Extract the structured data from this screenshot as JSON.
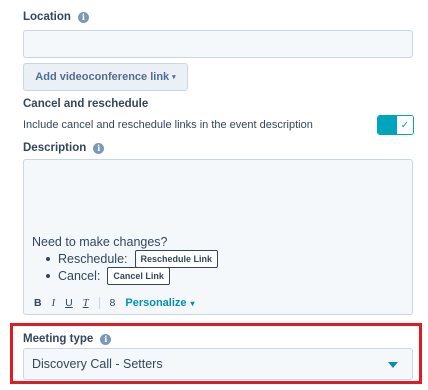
{
  "location": {
    "label": "Location",
    "value": "",
    "placeholder": ""
  },
  "videoconference": {
    "button_label": "Add videoconference link",
    "caret": "▾"
  },
  "cancel_reschedule": {
    "heading": "Cancel and reschedule",
    "description": "Include cancel and reschedule links in the event description",
    "toggle_on": true
  },
  "description": {
    "label": "Description",
    "intro": "Need to make changes?",
    "reschedule_label": "Reschedule:",
    "reschedule_chip": "Reschedule Link",
    "cancel_label": "Cancel:",
    "cancel_chip": "Cancel Link"
  },
  "toolbar": {
    "bold": "B",
    "italic": "I",
    "underline": "U",
    "clear_format": "T",
    "link": "8",
    "personalize": "Personalize",
    "personalize_caret": "▾"
  },
  "meeting_type": {
    "label": "Meeting type",
    "selected": "Discovery Call - Setters"
  },
  "colors": {
    "accent": "#00a4bd",
    "link": "#0091ae",
    "highlight": "#e01c23",
    "text": "#33475b"
  },
  "icons": {
    "info": "info-icon",
    "check": "check-icon",
    "chevron": "chevron-down-icon"
  }
}
